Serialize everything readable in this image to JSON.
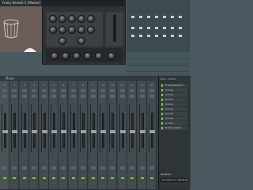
{
  "plugin_window": {
    "title": "Fruity Reverb 2 (Master)"
  },
  "mixer": {
    "title": "Mixer",
    "tracks": [
      "M",
      "1",
      "2",
      "3",
      "4",
      "5",
      "6",
      "7",
      "8",
      "9",
      "10",
      "11",
      "12",
      "13",
      "14",
      "15"
    ],
    "side_panel": {
      "title": "Mixer - Master",
      "slots": [
        "Fruity Reverb 2",
        "(none)",
        "(none)",
        "(none)",
        "(none)",
        "(none)",
        "(none)",
        "(none)",
        "(none)",
        "Fruity Limiter"
      ],
      "bottom_label": "Speakers",
      "output": "Headphones (Realtek...)"
    }
  },
  "colors": {
    "accent": "#7dcf3b",
    "background": "#4a5a60",
    "mixer_bg": "#2a3034"
  }
}
